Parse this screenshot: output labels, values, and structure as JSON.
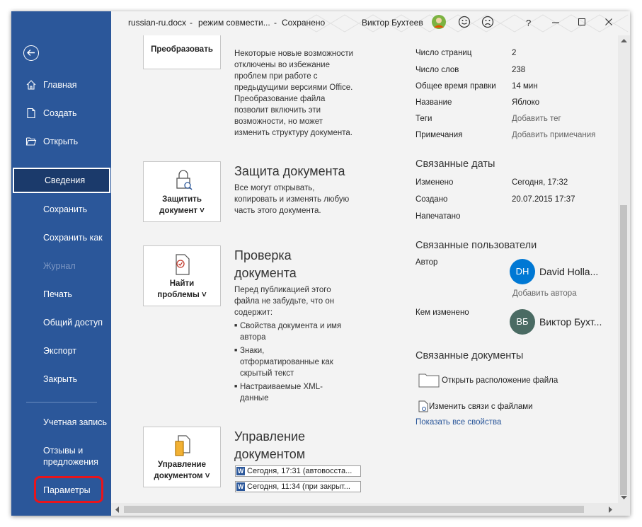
{
  "titlebar": {
    "filename": "russian-ru.docx",
    "mode": "режим совмести...",
    "status": "Сохранено",
    "separator": "-",
    "user": "Виктор Бухтеев",
    "help": "?"
  },
  "sidebar": {
    "items": [
      {
        "label": "Главная"
      },
      {
        "label": "Создать"
      },
      {
        "label": "Открыть"
      },
      {
        "label": "Сведения"
      },
      {
        "label": "Сохранить"
      },
      {
        "label": "Сохранить как"
      },
      {
        "label": "Журнал"
      },
      {
        "label": "Печать"
      },
      {
        "label": "Общий доступ"
      },
      {
        "label": "Экспорт"
      },
      {
        "label": "Закрыть"
      }
    ],
    "bottom": [
      {
        "label": "Учетная запись"
      },
      {
        "label": "Отзывы и предложения"
      },
      {
        "label": "Параметры"
      }
    ]
  },
  "convert": {
    "button_label": "Преобразовать",
    "text": [
      "Некоторые новые возможности",
      "отключены во избежание",
      "проблем при работе с",
      "предыдущими версиями Office.",
      "Преобразование файла",
      "позволит включить эти",
      "возможности, но может",
      "изменить структуру документа."
    ]
  },
  "protect": {
    "button_line1": "Защитить",
    "button_line2": "документ ˅",
    "title": "Защита документа",
    "text": [
      "Все могут открывать,",
      "копировать и изменять любую",
      "часть этого документа."
    ]
  },
  "inspect": {
    "button_line1": "Найти",
    "button_line2": "проблемы ˅",
    "title_line1": "Проверка",
    "title_line2": "документа",
    "text": [
      "Перед публикацией этого",
      "файла не забудьте, что он",
      "содержит:"
    ],
    "bullets": [
      [
        "Свойства документа и имя",
        "автора"
      ],
      [
        "Знаки,",
        "отформатированные как",
        "скрытый текст"
      ],
      [
        "Настраиваемые XML-",
        "данные"
      ]
    ]
  },
  "manage": {
    "button_line1": "Управление",
    "button_line2": "документом ˅",
    "title_line1": "Управление",
    "title_line2": "документом",
    "versions": [
      "Сегодня, 17:31 (автовосста...",
      "Сегодня, 11:34 (при закрыт..."
    ]
  },
  "properties": {
    "rows": [
      {
        "label": "Число страниц",
        "value": "2"
      },
      {
        "label": "Число слов",
        "value": "238"
      },
      {
        "label": "Общее время правки",
        "value": "14 мин"
      },
      {
        "label": "Название",
        "value": "Яблоко"
      },
      {
        "label": "Теги",
        "value": "Добавить тег"
      },
      {
        "label": "Примечания",
        "value": "Добавить примечания"
      }
    ]
  },
  "dates": {
    "title": "Связанные даты",
    "rows": [
      {
        "label": "Изменено",
        "value": "Сегодня, 17:32"
      },
      {
        "label": "Создано",
        "value": "20.07.2015 17:37"
      },
      {
        "label": "Напечатано",
        "value": ""
      }
    ]
  },
  "people": {
    "title": "Связанные пользователи",
    "author_label": "Автор",
    "author_initials": "DH",
    "author_name": "David Holla...",
    "author_color": "#0078d4",
    "add_author": "Добавить автора",
    "modified_label": "Кем изменено",
    "modifier_initials": "ВБ",
    "modifier_name": "Виктор Бухт...",
    "modifier_color": "#4a6b63"
  },
  "related_docs": {
    "title": "Связанные документы",
    "open_location": "Открыть расположение файла",
    "edit_links": "Изменить связи с файлами",
    "show_all": "Показать все свойства"
  }
}
